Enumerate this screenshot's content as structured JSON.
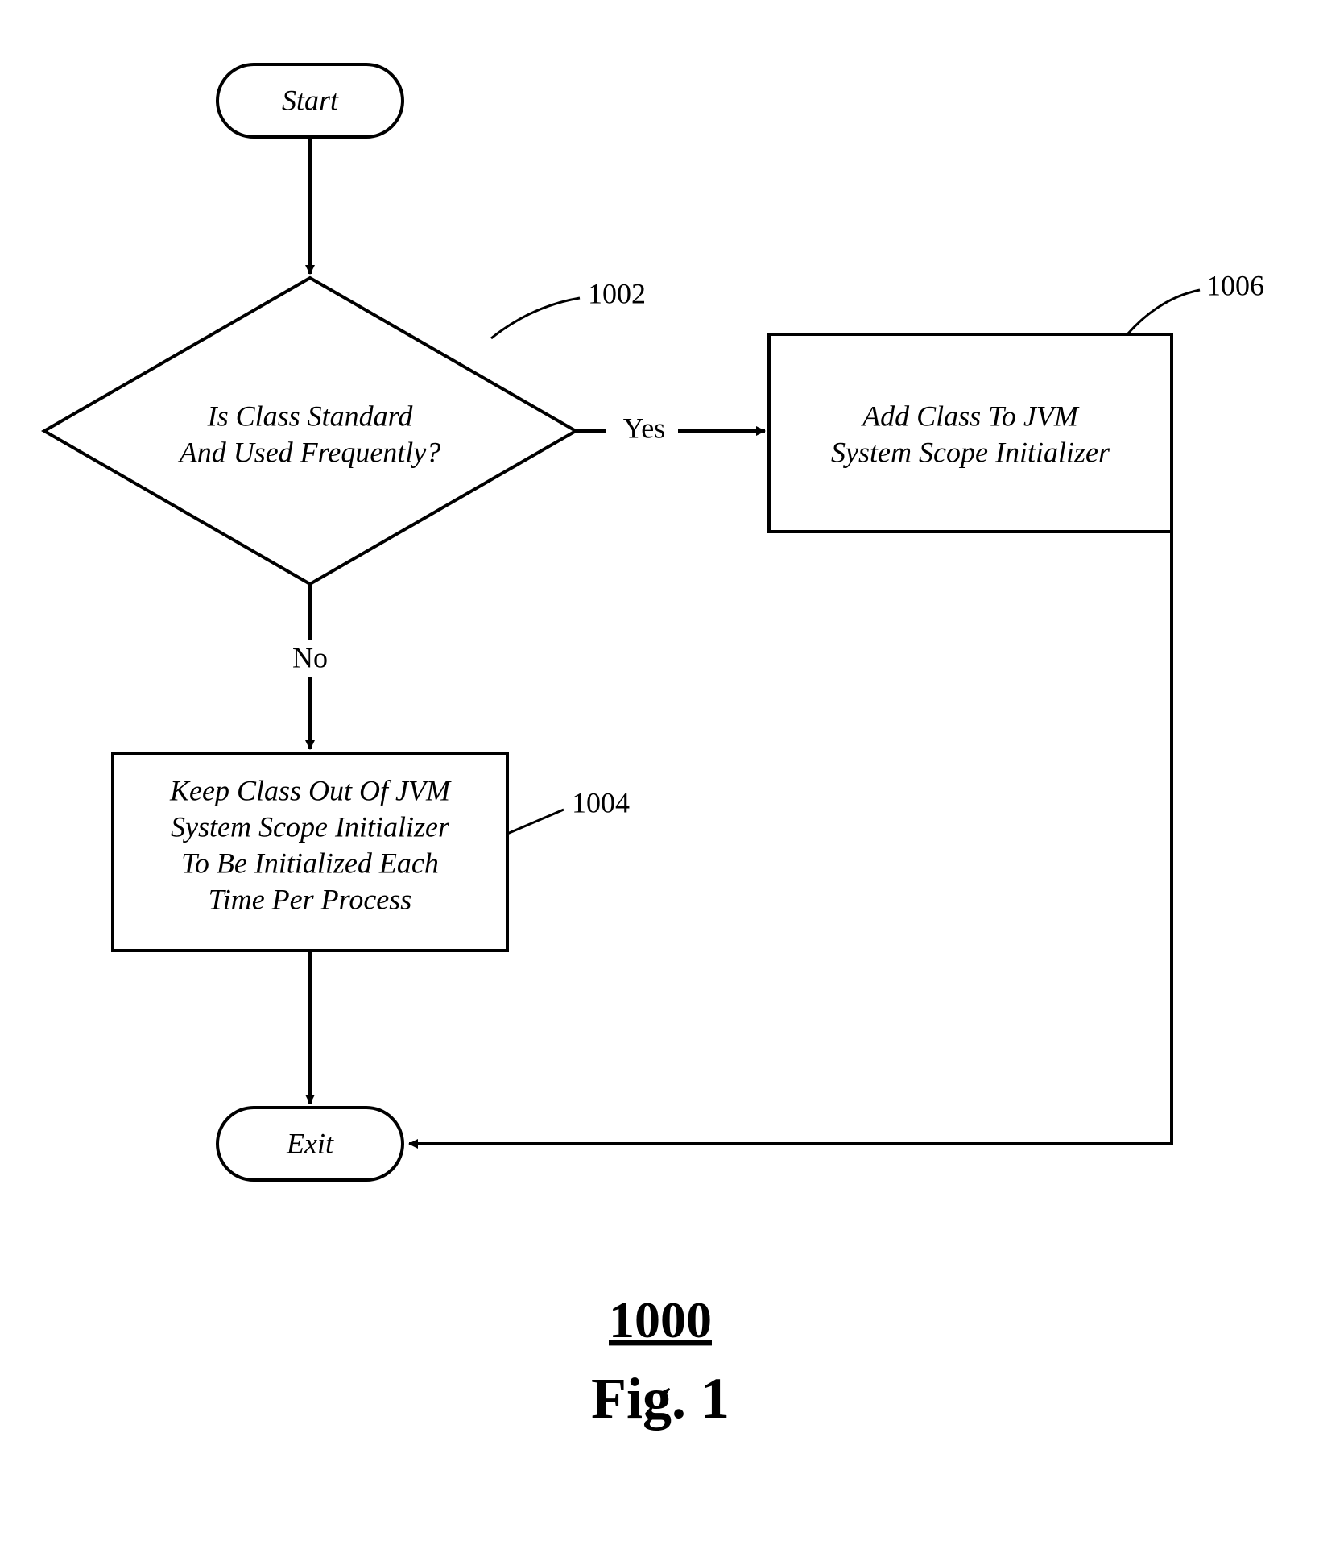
{
  "flowchart": {
    "start": "Start",
    "exit": "Exit",
    "decision": {
      "line1": "Is Class Standard",
      "line2": "And Used Frequently?",
      "ref": "1002"
    },
    "processNo": {
      "line1": "Keep Class Out Of JVM",
      "line2": "System Scope Initializer",
      "line3": "To Be Initialized Each",
      "line4": "Time Per Process",
      "ref": "1004"
    },
    "processYes": {
      "line1": "Add Class To JVM",
      "line2": "System Scope Initializer",
      "ref": "1006"
    },
    "edges": {
      "yes": "Yes",
      "no": "No"
    }
  },
  "figure": {
    "number": "1000",
    "caption": "Fig. 1"
  }
}
